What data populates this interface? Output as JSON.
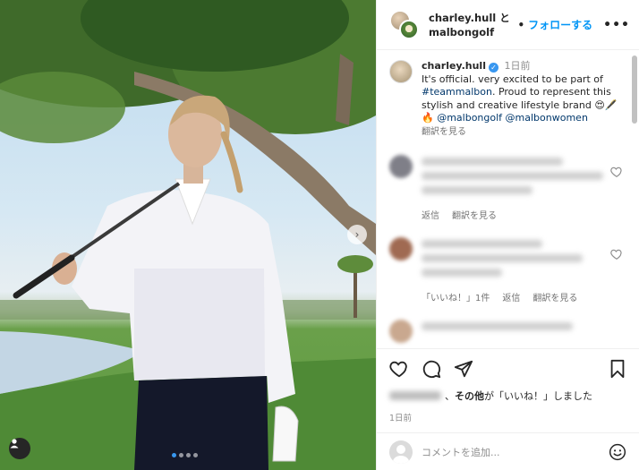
{
  "post": {
    "image_alt": "",
    "carousel": {
      "count": 4,
      "active_index": 0
    }
  },
  "header": {
    "user1": "charley.hull",
    "joiner": " と",
    "user2": "malbongolf",
    "follow_label": "フォローする",
    "more_label": "•••"
  },
  "caption": {
    "username": "charley.hull",
    "time": "1日前",
    "text_plain": "It's official. very excited to be part of ",
    "hashtag": "#teammalbon",
    "text_plain2": ". Proud to represent this stylish and creative lifestyle brand 😍🖋️🔥 ",
    "mention1": "@malbongolf",
    "mention2": "@malbonwomen",
    "translate": "翻訳を見る"
  },
  "comments": [
    {
      "actions": [
        "返信",
        "翻訳を見る"
      ]
    },
    {
      "actions": [
        "「いいね！」1件",
        "返信",
        "翻訳を見る"
      ]
    }
  ],
  "footer": {
    "likes_suffix": "、",
    "likes_bold": "その他",
    "likes_tail": "が「いいね！」しました",
    "post_time": "1日前",
    "comment_placeholder": "コメントを追加..."
  },
  "colors": {
    "accent": "#0095f6",
    "verified": "#3897f0",
    "hashtag": "#00376b"
  }
}
